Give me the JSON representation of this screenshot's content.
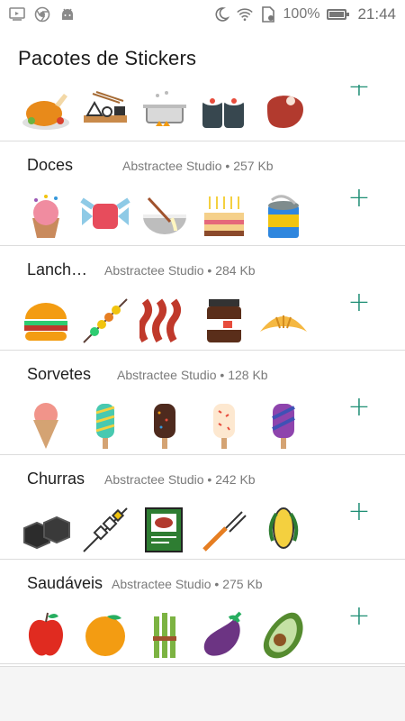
{
  "status_bar": {
    "battery": "100%",
    "time": "21:44",
    "icons": [
      "screen-cast-icon",
      "chrome-icon",
      "android-icon",
      "moon-icon",
      "wifi-icon",
      "sim-icon",
      "battery-icon"
    ]
  },
  "header": {
    "title": "Pacotes de Stickers"
  },
  "colors": {
    "accent": "#1e8e74"
  },
  "add_label": "+",
  "packs": [
    {
      "name": "",
      "author": "",
      "size": "",
      "stickers": [
        "roast-chicken",
        "sushi-board",
        "cooking-pot",
        "sushi-rolls",
        "steak"
      ]
    },
    {
      "name": "Doces",
      "author": "Abstractee Studio",
      "size": "257 Kb",
      "meta": "Abstractee Studio • 257 Kb",
      "stickers": [
        "cupcake",
        "candy",
        "mixing-bowl",
        "birthday-cake",
        "condensed-milk-can"
      ]
    },
    {
      "name": "Lanch…",
      "author": "Abstractee Studio",
      "size": "284 Kb",
      "meta": "Abstractee Studio • 284 Kb",
      "stickers": [
        "burger",
        "kebab",
        "bacon",
        "nutella-jar",
        "croissant"
      ]
    },
    {
      "name": "Sorvetes",
      "author": "Abstractee Studio",
      "size": "128 Kb",
      "meta": "Abstractee Studio • 128 Kb",
      "stickers": [
        "ice-cream-cone",
        "popsicle-striped",
        "popsicle-chocolate",
        "popsicle-sprinkles",
        "popsicle-purple"
      ]
    },
    {
      "name": "Churras",
      "author": "Abstractee Studio",
      "size": "242 Kb",
      "meta": "Abstractee Studio • 242 Kb",
      "stickers": [
        "charcoal",
        "skewer",
        "meat-book",
        "bbq-fork",
        "corn"
      ]
    },
    {
      "name": "Saudáveis",
      "author": "Abstractee Studio",
      "size": "275 Kb",
      "meta": "Abstractee Studio • 275 Kb",
      "stickers": [
        "apple",
        "orange",
        "asparagus",
        "eggplant",
        "avocado"
      ]
    }
  ]
}
